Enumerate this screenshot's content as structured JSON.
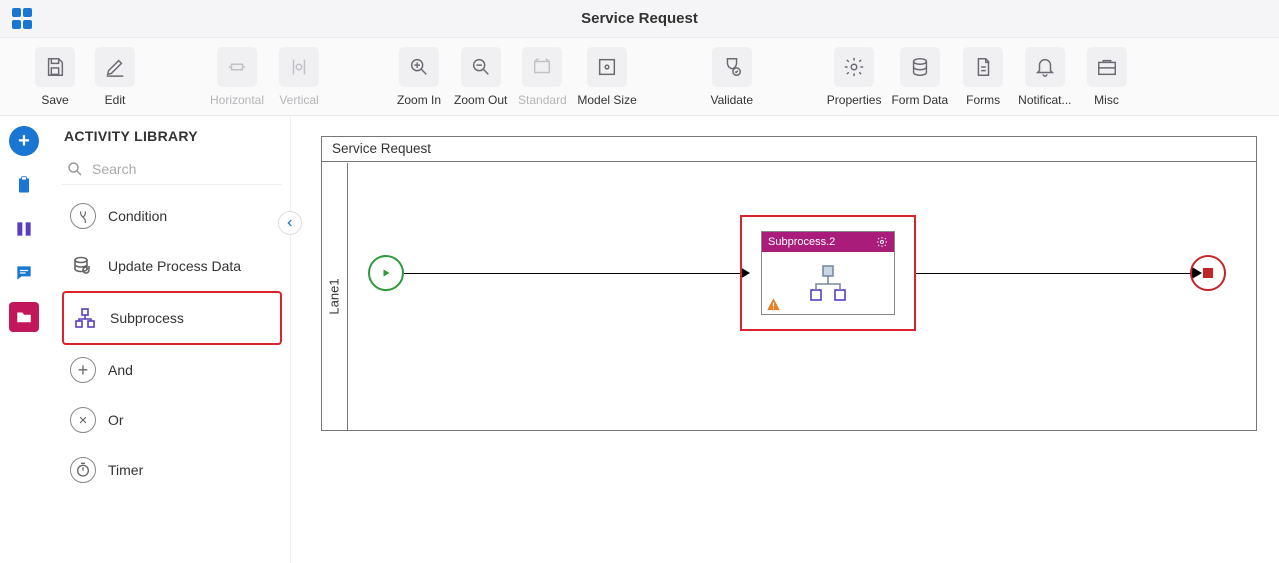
{
  "header": {
    "title": "Service Request"
  },
  "toolbar": {
    "save": "Save",
    "edit": "Edit",
    "horizontal": "Horizontal",
    "vertical": "Vertical",
    "zoomin": "Zoom In",
    "zoomout": "Zoom Out",
    "standard": "Standard",
    "modelsize": "Model Size",
    "validate": "Validate",
    "properties": "Properties",
    "formdata": "Form Data",
    "forms": "Forms",
    "notifications": "Notificat...",
    "misc": "Misc"
  },
  "sidebar": {
    "heading": "ACTIVITY LIBRARY",
    "search_placeholder": "Search",
    "items": {
      "condition": "Condition",
      "update_process_data": "Update Process Data",
      "subprocess": "Subprocess",
      "and": "And",
      "or": "Or",
      "timer": "Timer"
    }
  },
  "canvas": {
    "title": "Service Request",
    "lane": "Lane1",
    "subprocess_label": "Subprocess.2"
  }
}
